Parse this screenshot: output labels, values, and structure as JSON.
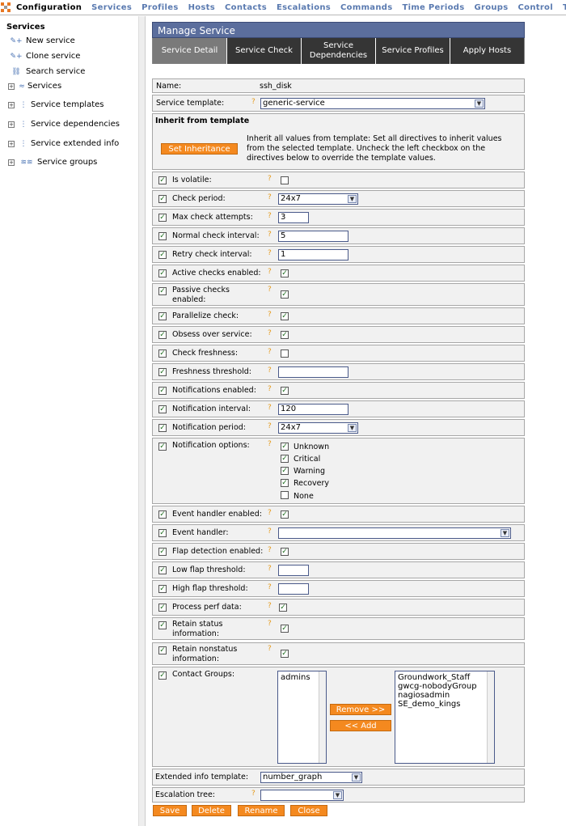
{
  "topnav": {
    "items": [
      "Configuration",
      "Services",
      "Profiles",
      "Hosts",
      "Contacts",
      "Escalations",
      "Commands",
      "Time Periods",
      "Groups",
      "Control",
      "Tools"
    ]
  },
  "sidebar": {
    "title": "Services",
    "items": [
      {
        "label": "New service"
      },
      {
        "label": "Clone service"
      },
      {
        "label": "Search service"
      },
      {
        "label": "Services"
      },
      {
        "label": "Service templates"
      },
      {
        "label": "Service dependencies"
      },
      {
        "label": "Service extended info"
      },
      {
        "label": "Service groups"
      }
    ]
  },
  "panel": {
    "title": "Manage Service",
    "tabs": [
      "Service Detail",
      "Service Check",
      "Service Dependencies",
      "Service Profiles",
      "Apply Hosts"
    ]
  },
  "form": {
    "name_label": "Name:",
    "name_value": "ssh_disk",
    "template_label": "Service template:",
    "template_value": "generic-service",
    "inherit_title": "Inherit from template",
    "inherit_button": "Set Inheritance",
    "inherit_note": "Inherit all values from template: Set all directives to inherit values from the selected template. Uncheck the left checkbox on the directives below to override the template values.",
    "is_volatile": "Is volatile:",
    "check_period": "Check period:",
    "check_period_value": "24x7",
    "max_check": "Max check attempts:",
    "max_check_value": "3",
    "normal_interval": "Normal check interval:",
    "normal_interval_value": "5",
    "retry_interval": "Retry check interval:",
    "retry_interval_value": "1",
    "active_checks": "Active checks enabled:",
    "passive_checks": "Passive checks enabled:",
    "parallelize": "Parallelize check:",
    "obsess": "Obsess over service:",
    "check_fresh": "Check freshness:",
    "fresh_threshold": "Freshness threshold:",
    "notif_enabled": "Notifications enabled:",
    "notif_interval": "Notification interval:",
    "notif_interval_value": "120",
    "notif_period": "Notification period:",
    "notif_period_value": "24x7",
    "notif_options": "Notification options:",
    "opt_unknown": "Unknown",
    "opt_critical": "Critical",
    "opt_warning": "Warning",
    "opt_recovery": "Recovery",
    "opt_none": "None",
    "event_enabled": "Event handler enabled:",
    "event_handler": "Event handler:",
    "flap_enabled": "Flap detection enabled:",
    "low_flap": "Low flap threshold:",
    "high_flap": "High flap threshold:",
    "perf_data": "Process perf data:",
    "retain_status": "Retain status information:",
    "retain_nonstatus": "Retain nonstatus information:",
    "contact_groups": "Contact Groups:",
    "cg_available": [
      "admins"
    ],
    "cg_selected": [
      "Groundwork_Staff",
      "gwcg-nobodyGroup",
      "nagiosadmin",
      "SE_demo_kings"
    ],
    "remove_btn": "Remove >>",
    "add_btn": "<< Add",
    "ext_info": "Extended info template:",
    "ext_info_value": "number_graph",
    "escalation": "Escalation tree:",
    "help": "?",
    "check": "✓"
  },
  "actions": {
    "save": "Save",
    "delete": "Delete",
    "rename": "Rename",
    "close": "Close"
  }
}
